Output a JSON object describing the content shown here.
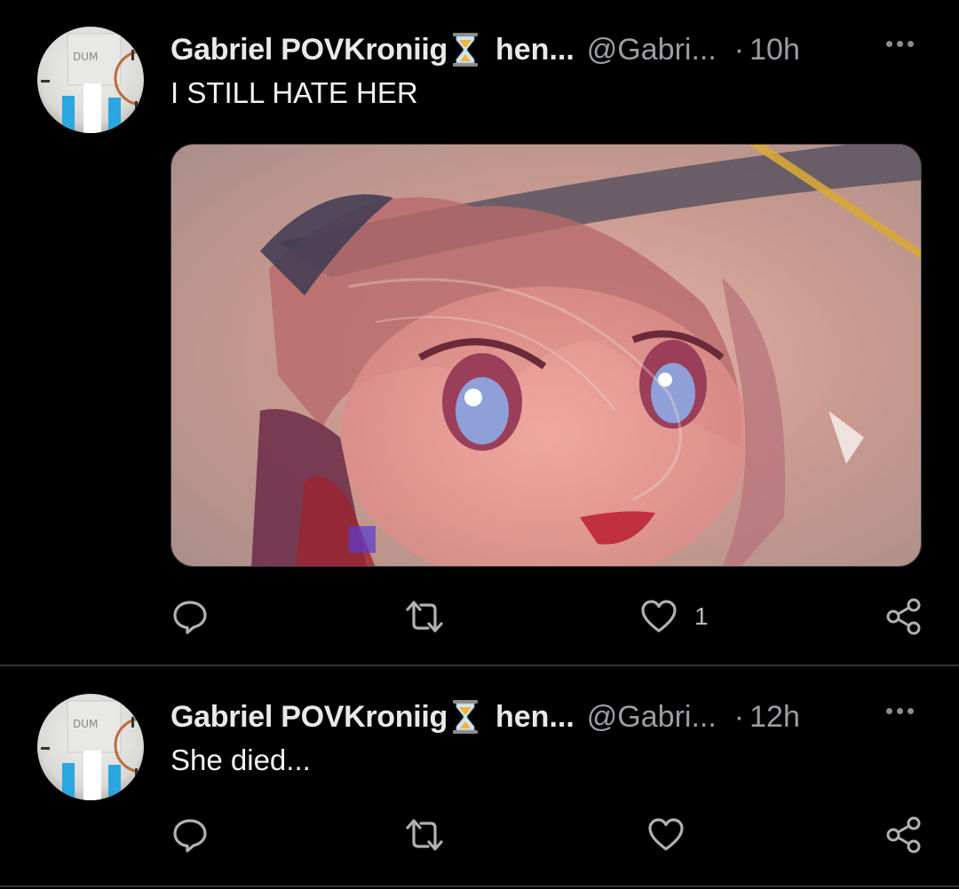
{
  "colors": {
    "background": "#000000",
    "text": "#e7e9ea",
    "muted": "#9a9ea2",
    "divider": "#2f3336",
    "hourglass": "#f5b335"
  },
  "tweets": [
    {
      "display_name": "Gabriel POVKroniig",
      "name_suffix": "hen...",
      "handle": "@Gabri...",
      "separator": "·",
      "time": "10h",
      "text": "I STILL HATE HER",
      "has_media": true,
      "likes": "1",
      "icons": {
        "reply": "reply-icon",
        "retweet": "retweet-icon",
        "like": "heart-icon",
        "share": "share-icon",
        "more": "more-icon",
        "emoji": "hourglass-icon"
      }
    },
    {
      "display_name": "Gabriel POVKroniig",
      "name_suffix": "hen...",
      "handle": "@Gabri...",
      "separator": "·",
      "time": "12h",
      "text": "She died...",
      "has_media": false,
      "likes": "",
      "icons": {
        "reply": "reply-icon",
        "retweet": "retweet-icon",
        "like": "heart-icon",
        "share": "share-icon",
        "more": "more-icon",
        "emoji": "hourglass-icon"
      }
    }
  ]
}
